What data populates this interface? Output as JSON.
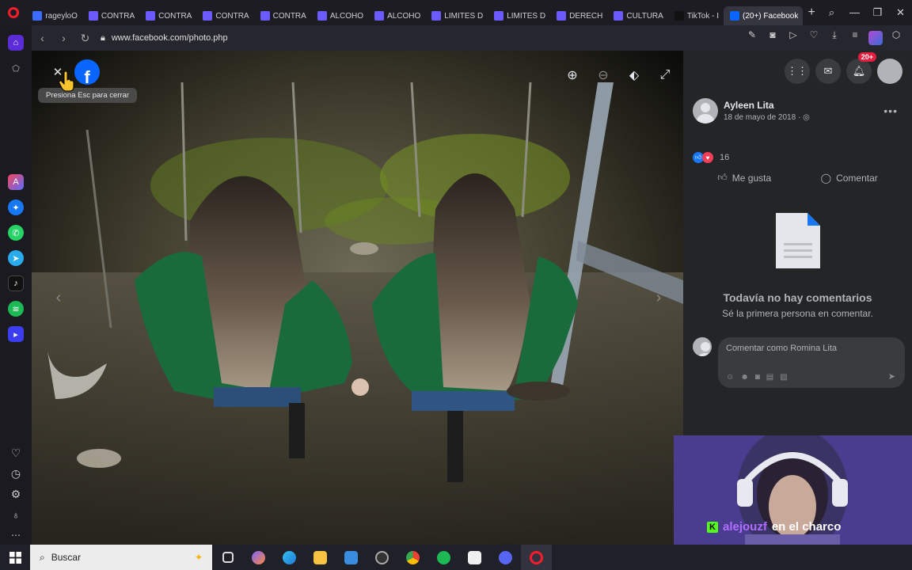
{
  "browser": {
    "tabs": [
      {
        "label": "rageyloO",
        "color": "#3b6cff"
      },
      {
        "label": "CONTRA",
        "color": "#6b5bff"
      },
      {
        "label": "CONTRA",
        "color": "#6b5bff"
      },
      {
        "label": "CONTRA",
        "color": "#6b5bff"
      },
      {
        "label": "CONTRA",
        "color": "#6b5bff"
      },
      {
        "label": "ALCOHO",
        "color": "#6b5bff"
      },
      {
        "label": "ALCOHO",
        "color": "#6b5bff"
      },
      {
        "label": "LIMITES D",
        "color": "#6b5bff"
      },
      {
        "label": "LIMITES D",
        "color": "#6b5bff"
      },
      {
        "label": "DERECH",
        "color": "#6b5bff"
      },
      {
        "label": "CULTURA",
        "color": "#6b5bff"
      },
      {
        "label": "TikTok - I",
        "color": "#111111"
      },
      {
        "label": "(20+) Facebook",
        "color": "#0866ff",
        "active": true
      }
    ],
    "url": "www.facebook.com/photo.php"
  },
  "viewer": {
    "close_tooltip": "Presiona Esc para cerrar",
    "logo_letter": "f"
  },
  "panel": {
    "notification_badge": "20+",
    "author_name": "Ayleen Lita",
    "post_date": "18 de mayo de 2018 · ",
    "reaction_count": "16",
    "like_label": "Me gusta",
    "comment_label": "Comentar",
    "no_comments_title": "Todavía no hay comentarios",
    "no_comments_sub": "Sé la primera persona en comentar.",
    "comment_placeholder": "Comentar como Romina Lita"
  },
  "stream": {
    "username": "alejouzf",
    "message": "en el charco"
  },
  "taskbar": {
    "search_label": "Buscar"
  }
}
